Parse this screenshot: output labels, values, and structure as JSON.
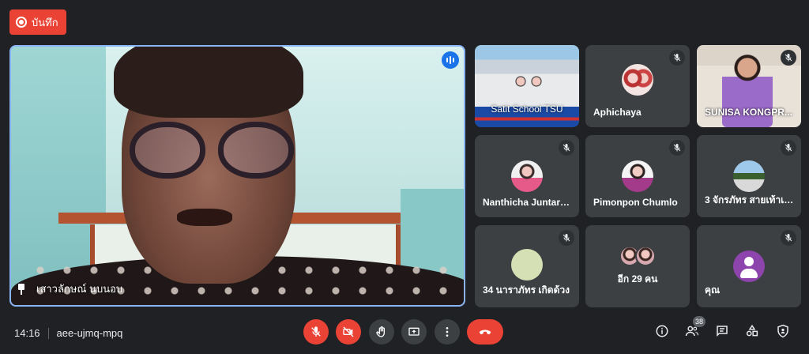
{
  "recording": {
    "label": "บันทึก"
  },
  "main": {
    "name": "เสาวลักษณ์ นบนอบ",
    "speaking": true
  },
  "tiles": [
    {
      "name": "Satit School TSU",
      "muted": false
    },
    {
      "name": "Aphichaya",
      "muted": true
    },
    {
      "name": "SUNISA KONGPR...",
      "muted": true
    },
    {
      "name": "Nanthicha Juntara...",
      "muted": true
    },
    {
      "name": "Pimonpon Chumlo",
      "muted": true
    },
    {
      "name": "3 จักรภัทร สายเท้าเอี้...",
      "muted": true
    },
    {
      "name": "34 นาราภัทร เกิดด้วง",
      "muted": true
    },
    {
      "name": "อีก 29 คน",
      "muted": false
    },
    {
      "name": "คุณ",
      "muted": true
    }
  ],
  "bottom": {
    "time": "14:16",
    "meeting_code": "aee-ujmq-mpq",
    "participant_count": "38"
  },
  "icons": {
    "mic": "mic-off-icon",
    "cam": "camera-off-icon",
    "hand": "raise-hand-icon",
    "present": "present-screen-icon",
    "more": "more-vert-icon",
    "hangup": "call-end-icon",
    "info": "info-icon",
    "people": "people-icon",
    "chat": "chat-icon",
    "activities": "activities-icon",
    "host": "host-controls-icon"
  },
  "colors": {
    "accent": "#8ab4f8",
    "danger": "#ea4335",
    "tile": "#3c4043",
    "background": "#202124"
  }
}
